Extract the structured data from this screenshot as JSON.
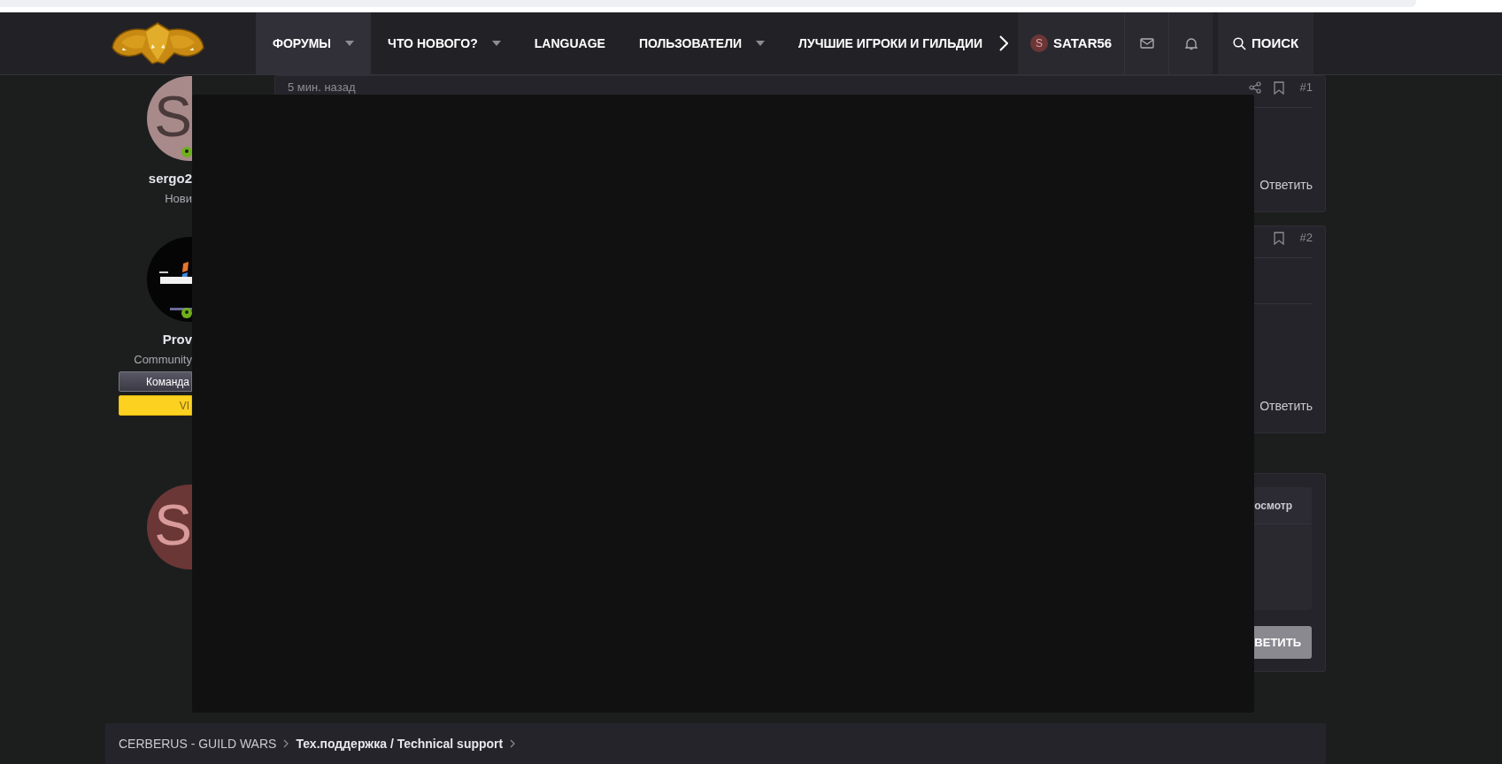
{
  "header": {
    "nav": [
      {
        "label": "ФОРУМЫ",
        "selected": true,
        "has_menu": true
      },
      {
        "label": "ЧТО НОВОГО?",
        "selected": false,
        "has_menu": true
      },
      {
        "label": "LANGUAGE",
        "selected": false,
        "has_menu": false
      },
      {
        "label": "ПОЛЬЗОВАТЕЛИ",
        "selected": false,
        "has_menu": true
      },
      {
        "label": "ЛУЧШИЕ ИГРОКИ И ГИЛЬДИИ",
        "selected": false,
        "has_menu": false
      }
    ],
    "user": {
      "avatar_letter": "S",
      "name": "SATAR56"
    },
    "search": {
      "label": "ПОИСК"
    }
  },
  "posts": [
    {
      "author": {
        "avatar": {
          "kind": "letter",
          "letter": "S"
        },
        "name": "sergo2",
        "title": "Нови",
        "online": true
      },
      "time": "5 мин. назад",
      "number": "#1",
      "reply": "Ответить"
    },
    {
      "author": {
        "name": "Prov",
        "title": "Community",
        "online": true,
        "banners": [
          {
            "label": "Команда",
            "kind": "team"
          },
          {
            "label": "VI",
            "kind": "vip"
          }
        ]
      },
      "number": "#2",
      "reply": "Ответить"
    }
  ],
  "reply_form": {
    "avatar_letter": "S",
    "tab": "осмотр",
    "submit": "ВЕТИТЬ"
  },
  "breadcrumbs": [
    {
      "label": "CERBERUS - GUILD WARS",
      "current": false
    },
    {
      "label": "Тех.поддержка / Technical support",
      "current": true
    }
  ]
}
